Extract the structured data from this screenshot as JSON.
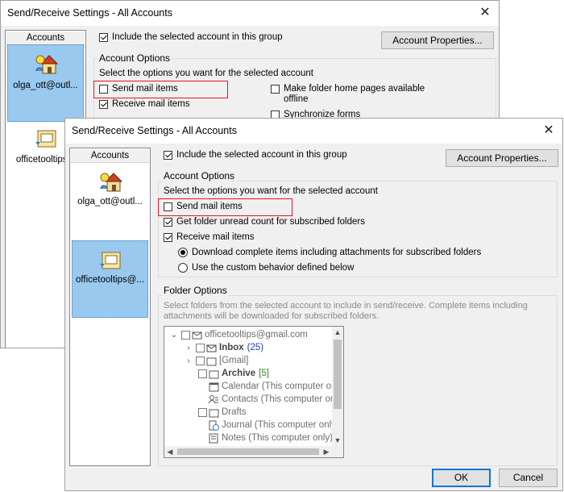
{
  "back_dialog": {
    "title": "Send/Receive Settings - All Accounts",
    "accounts_header": "Accounts",
    "accounts": [
      {
        "label": "olga_ott@outl...",
        "selected": true
      },
      {
        "label": "officetooltips...",
        "selected": false
      }
    ],
    "include_label": "Include the selected account in this group",
    "include_checked": true,
    "account_properties_label": "Account Properties...",
    "account_options_label": "Account Options",
    "select_options_text": "Select the options you want for the selected account",
    "send_mail_label": "Send mail items",
    "receive_mail_label": "Receive mail items",
    "folder_home_label_1": "Make folder home pages available",
    "folder_home_label_2": "offline",
    "sync_forms_label": "Synchronize forms"
  },
  "front_dialog": {
    "title": "Send/Receive Settings - All Accounts",
    "accounts_header": "Accounts",
    "accounts": [
      {
        "label": "olga_ott@outl...",
        "selected": false
      },
      {
        "label": "officetooltips@...",
        "selected": true
      }
    ],
    "include_label": "Include the selected account in this group",
    "include_checked": true,
    "account_properties_label": "Account Properties...",
    "account_options_label": "Account Options",
    "select_options_text": "Select the options you want for the selected account",
    "send_mail_label": "Send mail items",
    "send_mail_checked": false,
    "unread_count_label": "Get folder unread count for subscribed folders",
    "unread_count_checked": true,
    "receive_mail_label": "Receive mail items",
    "receive_mail_checked": true,
    "download_complete_label": "Download complete items including attachments for subscribed folders",
    "custom_behavior_label": "Use the custom behavior defined below",
    "folder_options_label": "Folder Options",
    "folder_options_desc_1": "Select folders from the selected account to include in send/receive. Complete items including",
    "folder_options_desc_2": "attachments will be downloaded for subscribed folders.",
    "tree": {
      "root": "officetooltips@gmail.com",
      "items": [
        {
          "label": "Inbox",
          "count": "(25)",
          "icon": "envelope-icon"
        },
        {
          "label": "[Gmail]",
          "icon": "folder-icon"
        },
        {
          "label": "Archive",
          "count": "[5]",
          "icon": "folder-icon"
        },
        {
          "label": "Calendar (This computer only)",
          "icon": "calendar-icon"
        },
        {
          "label": "Contacts (This computer only)",
          "icon": "contacts-icon"
        },
        {
          "label": "Drafts",
          "icon": "folder-icon"
        },
        {
          "label": "Journal (This computer only)",
          "icon": "journal-icon"
        },
        {
          "label": "Notes (This computer only)",
          "icon": "notes-icon"
        }
      ]
    },
    "ok_label": "OK",
    "cancel_label": "Cancel"
  },
  "colors": {
    "highlight": "#e81123",
    "selection": "#99c9ef",
    "count_blue": "#1f3fbf",
    "count_green": "#2e8b2e",
    "default_button_border": "#0078d7"
  }
}
